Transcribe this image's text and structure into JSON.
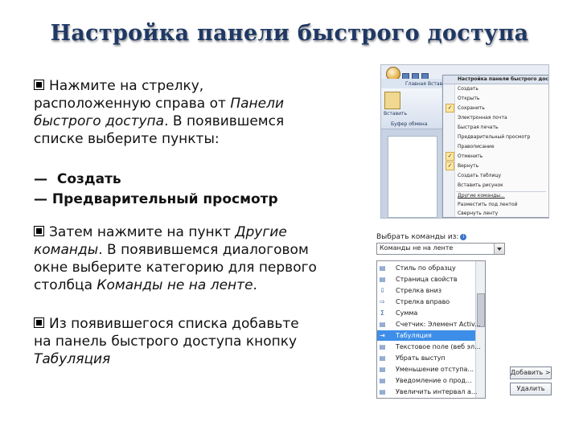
{
  "slide": {
    "title": "Настройка панели быстрого доступа",
    "para1_a": "Нажмите на стрелку,",
    "para1_b": "расположенную справа от ",
    "para1_b_italic": "Панели",
    "para1_c_italic": "быстрого доступа",
    "para1_c": ". В появившемся",
    "para1_d": "списке выберите пункты:",
    "item1": "Создать",
    "item2": "Предварительный просмотр",
    "para2_a": "Затем нажмите на пункт ",
    "para2_a_italic": "Другие",
    "para2_b_italic": "команды",
    "para2_b": ". В появившемся диалоговом",
    "para2_c": "окне выберите категорию для первого",
    "para2_d": "столбца ",
    "para2_d_italic": "Команды не на ленте",
    "para2_d_end": ".",
    "para3_a": "Из появившегося списка добавьте",
    "para3_b": "на панель быстрого доступа кнопку",
    "para3_c_italic": "Табуляция",
    "dash": "—"
  },
  "ribbon_screenshot": {
    "tab_main": "Главная",
    "tab_insert": "Вставка",
    "paste_label": "Вставить",
    "clipboard_label": "Буфер обмена",
    "menu_title": "Настройка панели быстрого доступа",
    "menu_items": [
      "Создать",
      "Открыть",
      "Сохранить",
      "Электронная почта",
      "Быстрая печать",
      "Предварительный просмотр",
      "Правописание",
      "Отменить",
      "Вернуть",
      "Создать таблицу",
      "Вставить рисунок",
      "Другие команды...",
      "Разместить под лентой",
      "Свернуть ленту"
    ],
    "check_mark": "✓"
  },
  "dialog_screenshot": {
    "choose_label": "Выбрать команды из:",
    "info_icon": "i",
    "combo_value": "Команды не на ленте",
    "list_items": [
      "Стиль по образцу",
      "Страница свойств",
      "Стрелка вниз",
      "Стрелка вправо",
      "Сумма",
      "Счетчик: Элемент Activ...",
      "Табуляция",
      "Текстовое поле (веб эл...",
      "Убрать выступ",
      "Уменьшение отступа...",
      "Уведомление о прод...",
      "Увеличить интервал а..."
    ],
    "selected_index": 6,
    "add_button": "Добавить >>",
    "remove_button": "Удалить",
    "icons": [
      "doc",
      "doc",
      "arrow-down",
      "arrow-right",
      "sigma",
      "doc",
      "tab",
      "doc",
      "doc",
      "doc",
      "doc",
      "doc"
    ]
  }
}
